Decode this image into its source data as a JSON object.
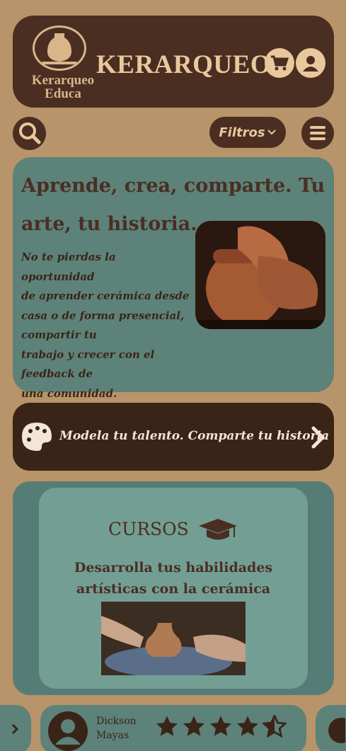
{
  "header": {
    "logo_text": "Kerarqueo\nEduca",
    "brand": "KERARQUEO",
    "cart_icon": "cart-icon",
    "user_icon": "user-icon"
  },
  "toolbar": {
    "search_icon": "search-icon",
    "filters_label": "Filtros",
    "menu_icon": "hamburger-menu-icon"
  },
  "hero": {
    "title": "Aprende, crea, comparte. Tu arte, tu historia.",
    "text": "No te pierdas la oportunidad\nde aprender cerámica desde\ncasa o de forma presencial,\ncompartir tu\ntrabajo y crecer con el\nfeedback de\nuna comunidad."
  },
  "banner": {
    "text": "Modela tu talento. Comparte tu historia",
    "icon": "palette-icon"
  },
  "courses": {
    "title": "CURSOS",
    "subtitle": "Desarrolla tus habilidades artísticas con la cerámica",
    "icon": "graduation-cap-icon"
  },
  "review": {
    "name": "Dickson\nMayas",
    "rating": 4.5,
    "max_rating": 5
  },
  "colors": {
    "background": "#b8946a",
    "dark_brown": "#4a2e22",
    "teal": "#5d8279",
    "cream": "#e8c89c"
  }
}
